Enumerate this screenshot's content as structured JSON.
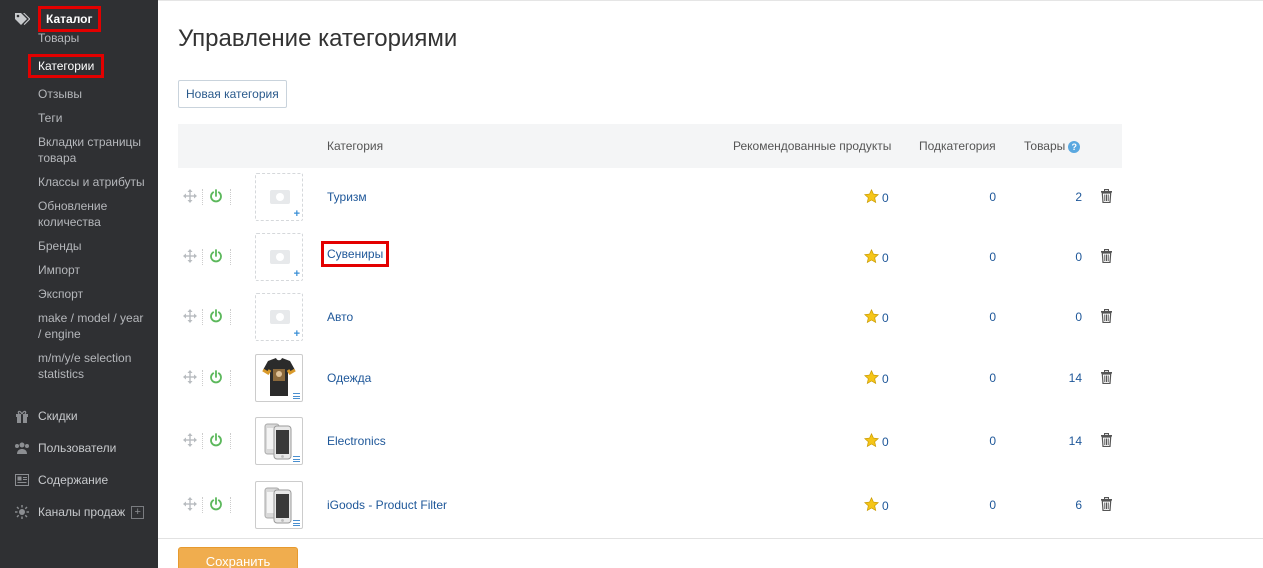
{
  "sidebar": {
    "catalog": {
      "label": "Каталог",
      "icon": "tags-icon"
    },
    "catalog_items": [
      {
        "label": "Товары",
        "active": false
      },
      {
        "label": "Категории",
        "active": true
      },
      {
        "label": "Отзывы",
        "active": false
      },
      {
        "label": "Теги",
        "active": false
      },
      {
        "label": "Вкладки страницы товара",
        "active": false
      },
      {
        "label": "Классы и атрибуты",
        "active": false
      },
      {
        "label": "Обновление количества",
        "active": false
      },
      {
        "label": "Бренды",
        "active": false
      },
      {
        "label": "Импорт",
        "active": false
      },
      {
        "label": "Экспорт",
        "active": false
      },
      {
        "label": "make / model / year / engine",
        "active": false
      },
      {
        "label": "m/m/y/e selection statistics",
        "active": false
      }
    ],
    "sections": [
      {
        "label": "Скидки",
        "icon": "gift-icon"
      },
      {
        "label": "Пользователи",
        "icon": "users-icon"
      },
      {
        "label": "Содержание",
        "icon": "content-icon"
      },
      {
        "label": "Каналы продаж",
        "icon": "sun-icon",
        "expand": "+"
      }
    ],
    "colors": {
      "background": "#2f3033",
      "highlight_border": "#e30000"
    }
  },
  "page": {
    "title": "Управление категориями",
    "new_button": "Новая категория",
    "save_button": "Сохранить"
  },
  "table": {
    "headers": {
      "category": "Категория",
      "recommended": "Рекомендованные продукты",
      "subcategory": "Подкатегория",
      "products": "Товары",
      "products_help": "?"
    },
    "rows": [
      {
        "name": "Туризм",
        "recommended": "0",
        "subcategories": "0",
        "products": "2",
        "image": "placeholder",
        "highlighted": false
      },
      {
        "name": "Сувениры",
        "recommended": "0",
        "subcategories": "0",
        "products": "0",
        "image": "placeholder",
        "highlighted": true
      },
      {
        "name": "Авто",
        "recommended": "0",
        "subcategories": "0",
        "products": "0",
        "image": "placeholder",
        "highlighted": false
      },
      {
        "name": "Одежда",
        "recommended": "0",
        "subcategories": "0",
        "products": "14",
        "image": "tshirt",
        "highlighted": false
      },
      {
        "name": "Electronics",
        "recommended": "0",
        "subcategories": "0",
        "products": "14",
        "image": "phone",
        "highlighted": false
      },
      {
        "name": "iGoods - Product Filter",
        "recommended": "0",
        "subcategories": "0",
        "products": "6",
        "image": "phone",
        "highlighted": false
      }
    ]
  },
  "colors": {
    "link": "#1e5799",
    "power": "#5cb85c",
    "star": "#f0b400",
    "save": "#f0ad4e"
  }
}
